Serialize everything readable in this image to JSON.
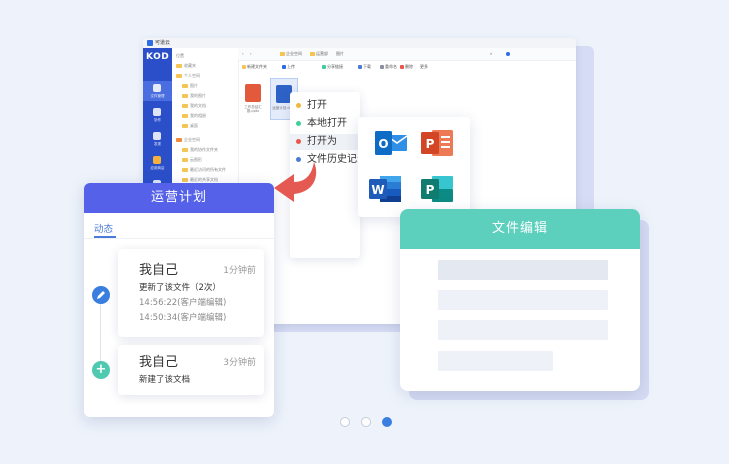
{
  "file_manager": {
    "app_name": "可道云",
    "brand": "KOD",
    "nav": [
      "文件管理",
      "协作",
      "发现",
      "应用商店",
      "设置"
    ],
    "tree": [
      "位置",
      "收藏夹",
      "个人空间",
      "图片",
      "我的图片",
      "我的文档",
      "我的相册",
      "桌面",
      "企业空间",
      "我的协作文件夹",
      "云图形",
      "最近访问的所有文件",
      "最近的共享文档"
    ],
    "breadcrumbs": [
      "企业空间",
      "运营部",
      "图片"
    ],
    "actions": [
      "新建文件夹",
      "上传",
      "分享链接",
      "下载",
      "重命名",
      "删除",
      "更多"
    ],
    "files": [
      "工作总结汇报.pptx",
      "运营计划.docx"
    ]
  },
  "context_menu": {
    "items": [
      {
        "label": "打开",
        "color": "#f0b93a"
      },
      {
        "label": "本地打开",
        "color": "#3ecf9b"
      },
      {
        "label": "打开为",
        "color": "#e9564c"
      },
      {
        "label": "文件历史记录",
        "color": "#4a7bd8"
      }
    ]
  },
  "apps": {
    "outlook": {
      "letter": "O",
      "color": "#0f6cc5"
    },
    "powerpoint": {
      "letter": "P",
      "color": "#d24625"
    },
    "word": {
      "letter": "W",
      "color": "#1f5bb8"
    },
    "publisher": {
      "letter": "P",
      "color": "#107c6f"
    }
  },
  "activity": {
    "title": "运营计划",
    "tab": "动态",
    "entries": [
      {
        "user": "我自己",
        "time": "1分钟前",
        "action": "更新了该文件（2次）",
        "details": [
          "14:56:22(客户端编辑)",
          "14:50:34(客户端编辑)"
        ]
      },
      {
        "user": "我自己",
        "time": "3分钟前",
        "action": "新建了该文档",
        "details": []
      }
    ]
  },
  "edit_card": {
    "title": "文件编辑"
  },
  "pagination": {
    "total": 3,
    "active": 3
  },
  "colors": {
    "background": "#eef3fb",
    "activity_header": "#5461e8",
    "edit_header": "#5dd0bd",
    "accent_blue": "#4a7bd8",
    "accent_green": "#4fc9b0",
    "arrow": "#e45a52"
  }
}
